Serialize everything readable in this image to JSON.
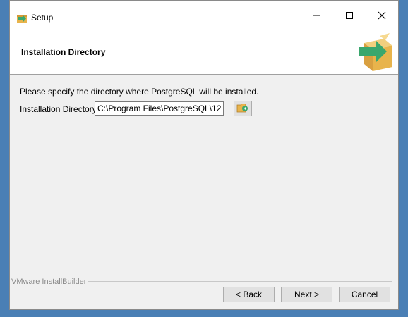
{
  "window": {
    "title": "Setup",
    "controls": {
      "minimize": "—",
      "maximize": "☐",
      "close": "✕"
    }
  },
  "header": {
    "title": "Installation Directory"
  },
  "body": {
    "instruction": "Please specify the directory where PostgreSQL will be installed.",
    "directory_label": "Installation Directory",
    "directory_value": "C:\\Program Files\\PostgreSQL\\12"
  },
  "footer": {
    "brand": "VMware InstallBuilder",
    "back_label": "< Back",
    "next_label": "Next >",
    "cancel_label": "Cancel"
  },
  "icons": {
    "app": "installer-box-icon",
    "header_logo": "installer-box-arrow-icon",
    "browse": "folder-browse-icon"
  },
  "colors": {
    "arrow": "#3aa76d",
    "box": "#e8b44c"
  }
}
